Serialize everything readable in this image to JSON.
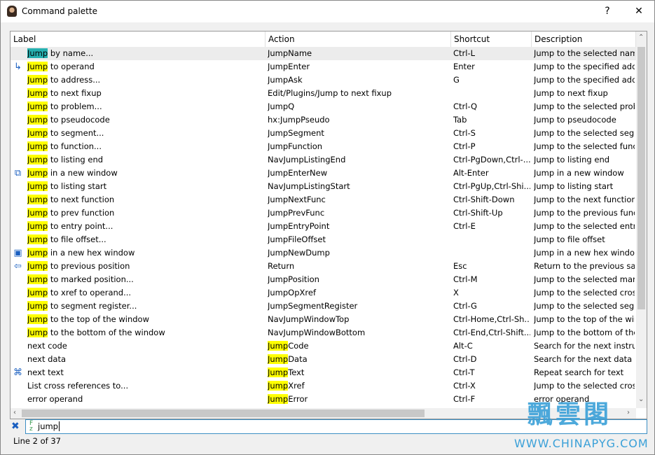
{
  "window": {
    "title": "Command palette",
    "help": "?",
    "close": "✕"
  },
  "columns": [
    "Label",
    "Action",
    "Shortcut",
    "Description"
  ],
  "highlight": "Jump",
  "rows": [
    {
      "pre": "",
      "hl": "Jump",
      "post": " by name...",
      "action": "JumpName",
      "shortcut": "Ctrl-L",
      "desc": "Jump to the selected name",
      "icon": "",
      "selected": true
    },
    {
      "pre": "",
      "hl": "Jump",
      "post": " to operand",
      "action": "JumpEnter",
      "shortcut": "Enter",
      "desc": "Jump to the specified address",
      "icon": "jump-arrow-icon"
    },
    {
      "pre": "",
      "hl": "Jump",
      "post": " to address...",
      "action": "JumpAsk",
      "shortcut": "G",
      "desc": "Jump to the specified address",
      "icon": ""
    },
    {
      "pre": "",
      "hl": "Jump",
      "post": " to next fixup",
      "action": "Edit/Plugins/Jump to next fixup",
      "shortcut": "",
      "desc": "Jump to next fixup",
      "icon": ""
    },
    {
      "pre": "",
      "hl": "Jump",
      "post": " to problem...",
      "action": "JumpQ",
      "shortcut": "Ctrl-Q",
      "desc": "Jump to the selected problem",
      "icon": ""
    },
    {
      "pre": "",
      "hl": "Jump",
      "post": " to pseudocode",
      "action": "hx:JumpPseudo",
      "shortcut": "Tab",
      "desc": "Jump to pseudocode",
      "icon": ""
    },
    {
      "pre": "",
      "hl": "Jump",
      "post": " to segment...",
      "action": "JumpSegment",
      "shortcut": "Ctrl-S",
      "desc": "Jump to the selected segment",
      "icon": ""
    },
    {
      "pre": "",
      "hl": "Jump",
      "post": " to function...",
      "action": "JumpFunction",
      "shortcut": "Ctrl-P",
      "desc": "Jump to the selected function",
      "icon": ""
    },
    {
      "pre": "",
      "hl": "Jump",
      "post": " to listing end",
      "action": "NavJumpListingEnd",
      "shortcut": "Ctrl-PgDown,Ctrl-...",
      "desc": "Jump to listing end",
      "icon": ""
    },
    {
      "pre": "",
      "hl": "Jump",
      "post": " in a new window",
      "action": "JumpEnterNew",
      "shortcut": "Alt-Enter",
      "desc": "Jump in a new window",
      "icon": "new-window-jump-icon"
    },
    {
      "pre": "",
      "hl": "Jump",
      "post": " to listing start",
      "action": "NavJumpListingStart",
      "shortcut": "Ctrl-PgUp,Ctrl-Shi...",
      "desc": "Jump to listing start",
      "icon": ""
    },
    {
      "pre": "",
      "hl": "Jump",
      "post": " to next function",
      "action": "JumpNextFunc",
      "shortcut": "Ctrl-Shift-Down",
      "desc": "Jump to the next function",
      "icon": ""
    },
    {
      "pre": "",
      "hl": "Jump",
      "post": " to prev function",
      "action": "JumpPrevFunc",
      "shortcut": "Ctrl-Shift-Up",
      "desc": "Jump to the previous function",
      "icon": ""
    },
    {
      "pre": "",
      "hl": "Jump",
      "post": " to entry point...",
      "action": "JumpEntryPoint",
      "shortcut": "Ctrl-E",
      "desc": "Jump to the selected entry point",
      "icon": ""
    },
    {
      "pre": "",
      "hl": "Jump",
      "post": " to file offset...",
      "action": "JumpFileOffset",
      "shortcut": "",
      "desc": "Jump to file offset",
      "icon": ""
    },
    {
      "pre": "",
      "hl": "Jump",
      "post": " in a new hex window",
      "action": "JumpNewDump",
      "shortcut": "",
      "desc": "Jump in a new hex window",
      "icon": "hex-window-icon"
    },
    {
      "pre": "",
      "hl": "Jump",
      "post": " to previous position",
      "action": "Return",
      "shortcut": "Esc",
      "desc": "Return to the previous saved position",
      "icon": "back-arrow-icon"
    },
    {
      "pre": "",
      "hl": "Jump",
      "post": " to marked position...",
      "action": "JumpPosition",
      "shortcut": "Ctrl-M",
      "desc": "Jump to the selected marked position",
      "icon": ""
    },
    {
      "pre": "",
      "hl": "Jump",
      "post": " to xref to operand...",
      "action": "JumpOpXref",
      "shortcut": "X",
      "desc": "Jump to the selected cross reference",
      "icon": ""
    },
    {
      "pre": "",
      "hl": "Jump",
      "post": " to segment register...",
      "action": "JumpSegmentRegister",
      "shortcut": "Ctrl-G",
      "desc": "Jump to the selected segment register",
      "icon": ""
    },
    {
      "pre": "",
      "hl": "Jump",
      "post": " to the top of the window",
      "action": "NavJumpWindowTop",
      "shortcut": "Ctrl-Home,Ctrl-Sh...",
      "desc": "Jump to the top of the window",
      "icon": ""
    },
    {
      "pre": "",
      "hl": "Jump",
      "post": " to the bottom of the window",
      "action": "NavJumpWindowBottom",
      "shortcut": "Ctrl-End,Ctrl-Shift...",
      "desc": "Jump to the bottom of the window",
      "icon": ""
    },
    {
      "label": "next code",
      "ahl": "Jump",
      "apost": "Code",
      "shortcut": "Alt-C",
      "desc": "Search for the next instruction",
      "icon": ""
    },
    {
      "label": "next data",
      "ahl": "Jump",
      "apost": "Data",
      "shortcut": "Ctrl-D",
      "desc": "Search for the next data item",
      "icon": ""
    },
    {
      "label": "next text",
      "ahl": "Jump",
      "apost": "Text",
      "shortcut": "Ctrl-T",
      "desc": "Repeat search for text",
      "icon": "binoculars-icon"
    },
    {
      "label": "List cross references to...",
      "ahl": "Jump",
      "apost": "Xref",
      "shortcut": "Ctrl-X",
      "desc": "Jump to the selected cross reference",
      "icon": ""
    },
    {
      "label": "error operand",
      "ahl": "Jump",
      "apost": "Error",
      "shortcut": "Ctrl-F",
      "desc": "error operand",
      "icon": ""
    }
  ],
  "search": {
    "value": "jump",
    "clear_icon": "clear-icon",
    "filter_icon": "fuzzy-filter-icon"
  },
  "status": "Line 2 of 37",
  "watermark": {
    "cn": "飄雲閣",
    "url": "WWW.CHINAPYG.COM"
  }
}
